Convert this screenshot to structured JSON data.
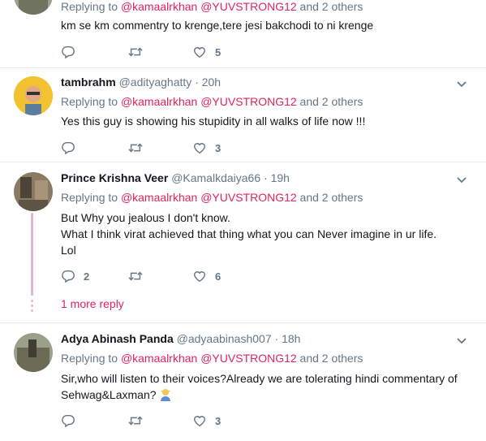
{
  "tweets": [
    {
      "reply_prefix": "Replying to",
      "mentions": "@kamaalrkhan @YUVSTRONG12",
      "reply_suffix": "and 2 others",
      "text": "km se km commentry to krenge,tere jesi bakchodi to ni krenge",
      "likes": "5"
    },
    {
      "name": "tambrahm",
      "handle": "@adityaghatty",
      "time": "· 20h",
      "reply_prefix": "Replying to",
      "mentions": "@kamaalrkhan @YUVSTRONG12",
      "reply_suffix": "and 2 others",
      "text": "Yes this guy is showing his stupidity in all walks of life now !!!",
      "likes": "3"
    },
    {
      "name": "Prince Krishna Veer",
      "handle": "@Kamalkdaiya66",
      "time": "· 19h",
      "reply_prefix": "Replying to",
      "mentions": "@kamaalrkhan @YUVSTRONG12",
      "reply_suffix": "and 2 others",
      "text_lines": [
        "But Why you jealous I don't know.",
        "What I think virat achieved that thing what you can Never imagine in ur life.",
        "Lol"
      ],
      "replies": "2",
      "likes": "6",
      "more_replies": "1 more reply"
    },
    {
      "name": "Adya Abinash Panda",
      "handle": "@adyaabinash007",
      "time": "· 18h",
      "reply_prefix": "Replying to",
      "mentions": "@kamaalrkhan @YUVSTRONG12",
      "reply_suffix": "and 2 others",
      "text_lines": [
        "Sir,who will listen to their voices?Already we are tolerating hindi commentary of",
        "Sehwag&Laxman?"
      ],
      "likes": "3"
    }
  ],
  "colors": {
    "mention": "#e0245e",
    "muted": "#657786",
    "thread": "#e5b6d1"
  },
  "icons": {
    "reply": "reply-icon",
    "retweet": "retweet-icon",
    "like": "heart-icon",
    "menu": "chevron-down-icon"
  }
}
